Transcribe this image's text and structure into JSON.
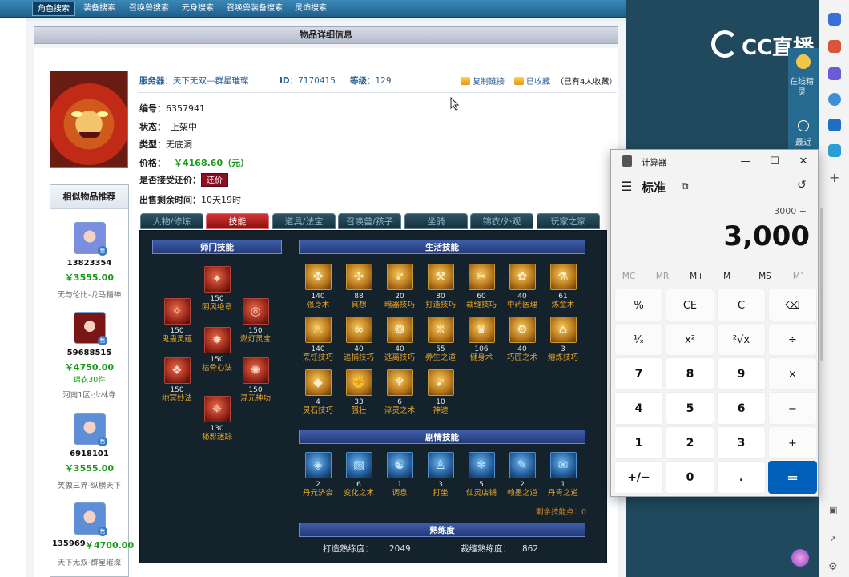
{
  "topnav": [
    "角色搜索",
    "装备搜索",
    "召唤兽搜索",
    "元身搜索",
    "召唤兽装备搜索",
    "灵饰搜索"
  ],
  "page_title": "物品详细信息",
  "server_line": {
    "server_label": "服务器：",
    "server_value": "天下无双—群星璀璨",
    "id_label": "ID：",
    "id_value": "7170415",
    "level_label": "等级：",
    "level_value": "129"
  },
  "actions": {
    "copy_link": "复制链接",
    "favorited": "已收藏",
    "fav_count": "（已有4人收藏）"
  },
  "item": {
    "serial_label": "编号：",
    "serial_value": "6357941",
    "status_label": "状态：",
    "status_value": "上架中",
    "type_label": "类型：",
    "type_value": "无底洞",
    "price_label": "价格：",
    "price_value": "￥4168.60（元）",
    "bargain_label": "是否接受还价：",
    "bargain_button": "还价",
    "time_label": "出售剩余时间：",
    "time_value": "10天19时"
  },
  "similar": {
    "title": "相似物品推荐",
    "items": [
      {
        "id": "13823354",
        "price": "￥3555.00",
        "extra": "",
        "server": "无与伦比-龙马精神",
        "color": "#6a8fd8"
      },
      {
        "id": "59688515",
        "price": "￥4750.00",
        "extra": "锦衣30件",
        "server": "河南1区-少林寺",
        "color": "#c84a4a"
      },
      {
        "id": "6918101",
        "price": "￥3555.00",
        "extra": "",
        "server": "笑傲三界-纵横天下",
        "color": "#5a8fd0"
      },
      {
        "id": "135969",
        "price": "￥4700.00",
        "extra": "",
        "server": "天下无双-群星璀璨",
        "color": "#5a8fd0"
      }
    ]
  },
  "skill_tabs": [
    "人物/修炼",
    "技能",
    "道具/法宝",
    "召唤兽/孩子",
    "坐骑",
    "锦衣/外观",
    "玩家之家"
  ],
  "skill_sections": {
    "school": "师门技能",
    "life": "生活技能",
    "plot": "剧情技能",
    "proficiency": "熟练度"
  },
  "school_skills": [
    {
      "level": "150",
      "name": "阴风绝章"
    },
    {
      "level": "150",
      "name": "鬼蛊灵蕴"
    },
    {
      "level": "150",
      "name": "燃灯灵宝"
    },
    {
      "level": "150",
      "name": "枯骨心法"
    },
    {
      "level": "150",
      "name": "地冥妙法"
    },
    {
      "level": "150",
      "name": "混元神功"
    },
    {
      "level": "130",
      "name": "秘影迷踪"
    }
  ],
  "life_skills": [
    {
      "level": "140",
      "name": "强身术"
    },
    {
      "level": "88",
      "name": "冥想"
    },
    {
      "level": "20",
      "name": "暗器技巧"
    },
    {
      "level": "80",
      "name": "打造技巧"
    },
    {
      "level": "60",
      "name": "裁缝技巧"
    },
    {
      "level": "40",
      "name": "中药医理"
    },
    {
      "level": "61",
      "name": "炼金术"
    },
    {
      "level": "140",
      "name": "烹饪技巧"
    },
    {
      "level": "40",
      "name": "追捕技巧"
    },
    {
      "level": "40",
      "name": "逃离技巧"
    },
    {
      "level": "55",
      "name": "养生之道"
    },
    {
      "level": "106",
      "name": "健身术"
    },
    {
      "level": "40",
      "name": "巧匠之术"
    },
    {
      "level": "3",
      "name": "熔炼技巧"
    },
    {
      "level": "4",
      "name": "灵石技巧"
    },
    {
      "level": "33",
      "name": "强壮"
    },
    {
      "level": "6",
      "name": "淬灵之术"
    },
    {
      "level": "10",
      "name": "神速"
    }
  ],
  "plot_skills": [
    {
      "level": "2",
      "name": "丹元济会"
    },
    {
      "level": "6",
      "name": "变化之术"
    },
    {
      "level": "1",
      "name": "调息"
    },
    {
      "level": "3",
      "name": "打坐"
    },
    {
      "level": "5",
      "name": "仙灵店铺"
    },
    {
      "level": "2",
      "name": "翰墨之道"
    },
    {
      "level": "1",
      "name": "丹青之道"
    }
  ],
  "remaining_points": "剩余技能点：0",
  "proficiency": {
    "forge_label": "打造熟练度：",
    "forge_value": "2049",
    "tailor_label": "裁缝熟练度：",
    "tailor_value": "862"
  },
  "cc_logo": "CC直播",
  "side_strip": {
    "item1": "在线精灵",
    "item2": "最近"
  },
  "calculator": {
    "title": "计算器",
    "mode": "标准",
    "expression": "3000 +",
    "display": "3,000",
    "memory": [
      "MC",
      "MR",
      "M+",
      "M−",
      "MS",
      "M˅"
    ],
    "keys": [
      [
        "%",
        "CE",
        "C",
        "⌫"
      ],
      [
        "¹⁄ₓ",
        "x²",
        "²√x",
        "÷"
      ],
      [
        "7",
        "8",
        "9",
        "×"
      ],
      [
        "4",
        "5",
        "6",
        "−"
      ],
      [
        "1",
        "2",
        "3",
        "+"
      ],
      [
        "+/−",
        "0",
        ".",
        "="
      ]
    ]
  }
}
